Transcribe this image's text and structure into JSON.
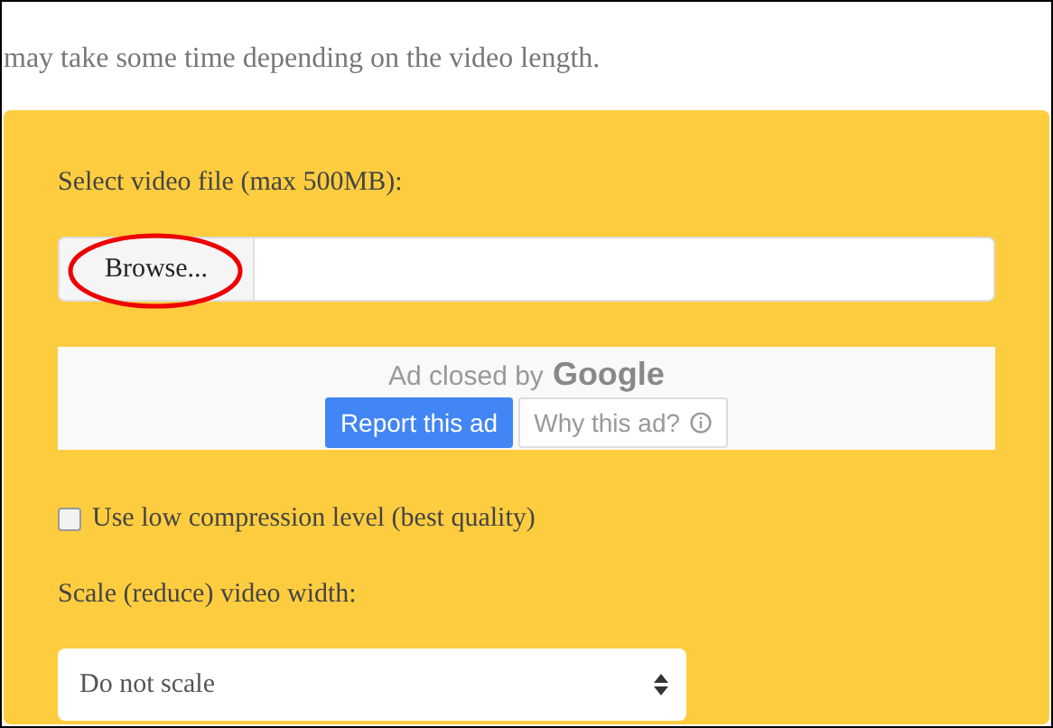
{
  "intro": "may take some time depending on the video length.",
  "form": {
    "file_label": "Select video file (max 500MB):",
    "browse_button": "Browse...",
    "ad": {
      "closed_text": "Ad closed by",
      "brand": "Google",
      "report_button": "Report this ad",
      "why_button": "Why this ad?"
    },
    "low_compression": {
      "label": "Use low compression level (best quality)",
      "checked": false
    },
    "scale_label": "Scale (reduce) video width:",
    "scale_select": "Do not scale"
  }
}
